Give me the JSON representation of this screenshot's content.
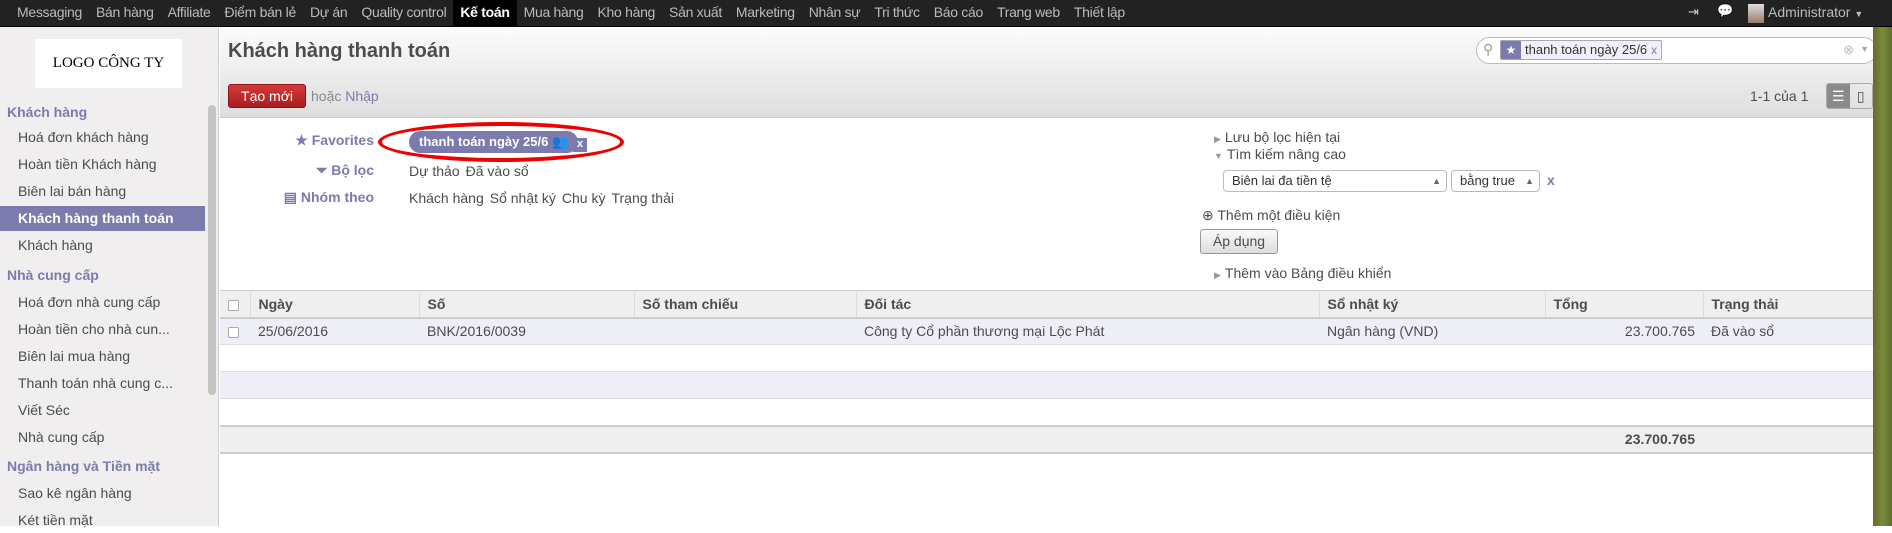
{
  "topbar": {
    "menu": [
      "Messaging",
      "Bán hàng",
      "Affiliate",
      "Điểm bán lẻ",
      "Dự án",
      "Quality control",
      "Kế toán",
      "Mua hàng",
      "Kho hàng",
      "Sản xuất",
      "Marketing",
      "Nhân sự",
      "Tri thức",
      "Báo cáo",
      "Trang web",
      "Thiết lập"
    ],
    "active": "Kế toán",
    "user": "Administrator"
  },
  "sidebar": {
    "logo": "LOGO CÔNG TY",
    "sections": [
      {
        "title": "Khách hàng",
        "items": [
          "Hoá đơn khách hàng",
          "Hoàn tiền Khách hàng",
          "Biên lai bán hàng",
          "Khách hàng thanh toán",
          "Khách hàng"
        ]
      },
      {
        "title": "Nhà cung cấp",
        "items": [
          "Hoá đơn nhà cung cấp",
          "Hoàn tiền cho nhà cun...",
          "Biên lai mua hàng",
          "Thanh toán nhà cung c...",
          "Viết Séc",
          "Nhà cung cấp"
        ]
      },
      {
        "title": "Ngân hàng và Tiền mặt",
        "items": [
          "Sao kê ngân hàng",
          "Két tiền mặt"
        ]
      }
    ],
    "active": "Khách hàng thanh toán"
  },
  "header": {
    "title": "Khách hàng thanh toán",
    "create": "Tạo mới",
    "or": "hoặc",
    "import": "Nhập",
    "pager": "1-1 của 1",
    "search_facet": "thanh toán ngày 25/6",
    "facet_remove": "x"
  },
  "filters": {
    "favorites_label": "Favorites",
    "favorite_tag": "thanh toán ngày 25/6",
    "favorite_remove": "x",
    "filter_label": "Bộ lọc",
    "filter_items": [
      "Dự thảo",
      "Đã vào sổ"
    ],
    "group_label": "Nhóm theo",
    "group_items": [
      "Khách hàng",
      "Sổ nhật ký",
      "Chu kỳ",
      "Trạng thải"
    ],
    "save_filter": "Lưu bộ lọc hiện tại",
    "advanced": "Tìm kiếm nâng cao",
    "field_select": "Biên lai đa tiền tệ",
    "op_select": "bằng true",
    "remove": "x",
    "add_condition": "Thêm một điều kiện",
    "apply": "Áp dụng",
    "add_dashboard": "Thêm vào Bảng điều khiển"
  },
  "table": {
    "columns": [
      "Ngày",
      "Số",
      "Số tham chiếu",
      "Đối tác",
      "Sổ nhật ký",
      "Tổng",
      "Trạng thải"
    ],
    "rows": [
      {
        "date": "25/06/2016",
        "number": "BNK/2016/0039",
        "ref": "",
        "partner": "Công ty Cổ phần thương mại Lộc Phát",
        "journal": "Ngân hàng (VND)",
        "total": "23.700.765",
        "state": "Đã vào sổ"
      }
    ],
    "footer_total": "23.700.765"
  },
  "colors": {
    "accent": "#7c7bad",
    "primary_button": "#c02828",
    "annotation": "#e00000"
  }
}
